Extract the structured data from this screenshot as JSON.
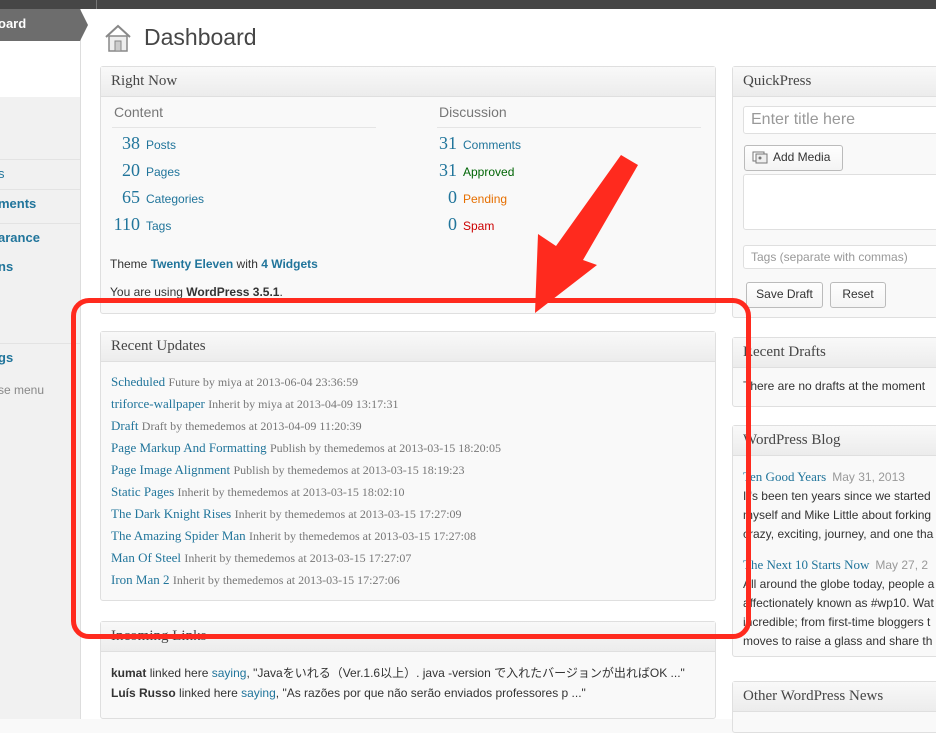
{
  "sidebar": {
    "active_item": "oard",
    "items": [
      {
        "label": "s"
      },
      {
        "label": "ments"
      },
      {
        "label": "arance"
      },
      {
        "label": "ns"
      },
      {
        "label": "gs"
      },
      {
        "label": "se menu"
      }
    ]
  },
  "page": {
    "title": "Dashboard"
  },
  "right_now": {
    "title": "Right Now",
    "content_heading": "Content",
    "discussion_heading": "Discussion",
    "content": [
      {
        "count": "38",
        "label": "Posts"
      },
      {
        "count": "20",
        "label": "Pages"
      },
      {
        "count": "65",
        "label": "Categories"
      },
      {
        "count": "110",
        "label": "Tags"
      }
    ],
    "discussion": [
      {
        "count": "31",
        "label": "Comments"
      },
      {
        "count": "31",
        "label": "Approved"
      },
      {
        "count": "0",
        "label": "Pending"
      },
      {
        "count": "0",
        "label": "Spam"
      }
    ],
    "theme_prefix": "Theme",
    "theme_name": "Twenty Eleven",
    "theme_with": "with",
    "widgets": "4 Widgets",
    "version_prefix": "You are using",
    "version": "WordPress 3.5.1",
    "version_suffix": "."
  },
  "recent_updates": {
    "title": "Recent Updates",
    "items": [
      {
        "title": "Scheduled",
        "meta": "Future by miya at 2013-06-04 23:36:59"
      },
      {
        "title": "triforce-wallpaper",
        "meta": "Inherit by miya at 2013-04-09 13:17:31"
      },
      {
        "title": "Draft",
        "meta": "Draft by themedemos at 2013-04-09 11:20:39"
      },
      {
        "title": "Page Markup And Formatting",
        "meta": "Publish by themedemos at 2013-03-15 18:20:05"
      },
      {
        "title": "Page Image Alignment",
        "meta": "Publish by themedemos at 2013-03-15 18:19:23"
      },
      {
        "title": "Static Pages",
        "meta": "Inherit by themedemos at 2013-03-15 18:02:10"
      },
      {
        "title": "The Dark Knight Rises",
        "meta": "Inherit by themedemos at 2013-03-15 17:27:09"
      },
      {
        "title": "The Amazing Spider Man",
        "meta": "Inherit by themedemos at 2013-03-15 17:27:08"
      },
      {
        "title": "Man Of Steel",
        "meta": "Inherit by themedemos at 2013-03-15 17:27:07"
      },
      {
        "title": "Iron Man 2",
        "meta": "Inherit by themedemos at 2013-03-15 17:27:06"
      }
    ]
  },
  "incoming_links": {
    "title": "Incoming Links",
    "items": [
      {
        "user": "kumat",
        "middle": "linked here",
        "link": "saying",
        "quote": ", \"Javaをいれる（Ver.1.6以上）. java -version で入れたバージョンが出ればOK ...\""
      },
      {
        "user": "Luís Russo",
        "middle": "linked here",
        "link": "saying",
        "quote": ", \"As razões por que não serão enviados professores p ...\""
      }
    ]
  },
  "quickpress": {
    "title": "QuickPress",
    "title_placeholder": "Enter title here",
    "add_media": "Add Media",
    "tags_placeholder": "Tags (separate with commas)",
    "save_draft": "Save Draft",
    "reset": "Reset"
  },
  "recent_drafts": {
    "title": "Recent Drafts",
    "empty": "There are no drafts at the moment"
  },
  "wp_blog": {
    "title": "WordPress Blog",
    "posts": [
      {
        "title": "Ten Good Years",
        "date": "May 31, 2013",
        "lines": [
          "It's been ten years since we started",
          "myself and Mike Little about forking",
          "crazy, exciting, journey, and one tha"
        ]
      },
      {
        "title": "The Next 10 Starts Now",
        "date": "May 27, 2",
        "lines": [
          "All around the globe today, people a",
          "affectionately known as #wp10. Wat",
          "incredible; from first-time bloggers t",
          "moves to raise a glass and share th"
        ]
      }
    ]
  },
  "other_news": {
    "title": "Other WordPress News"
  },
  "colors": {
    "accent": "#21759b",
    "annotation": "#ff2a1e"
  }
}
